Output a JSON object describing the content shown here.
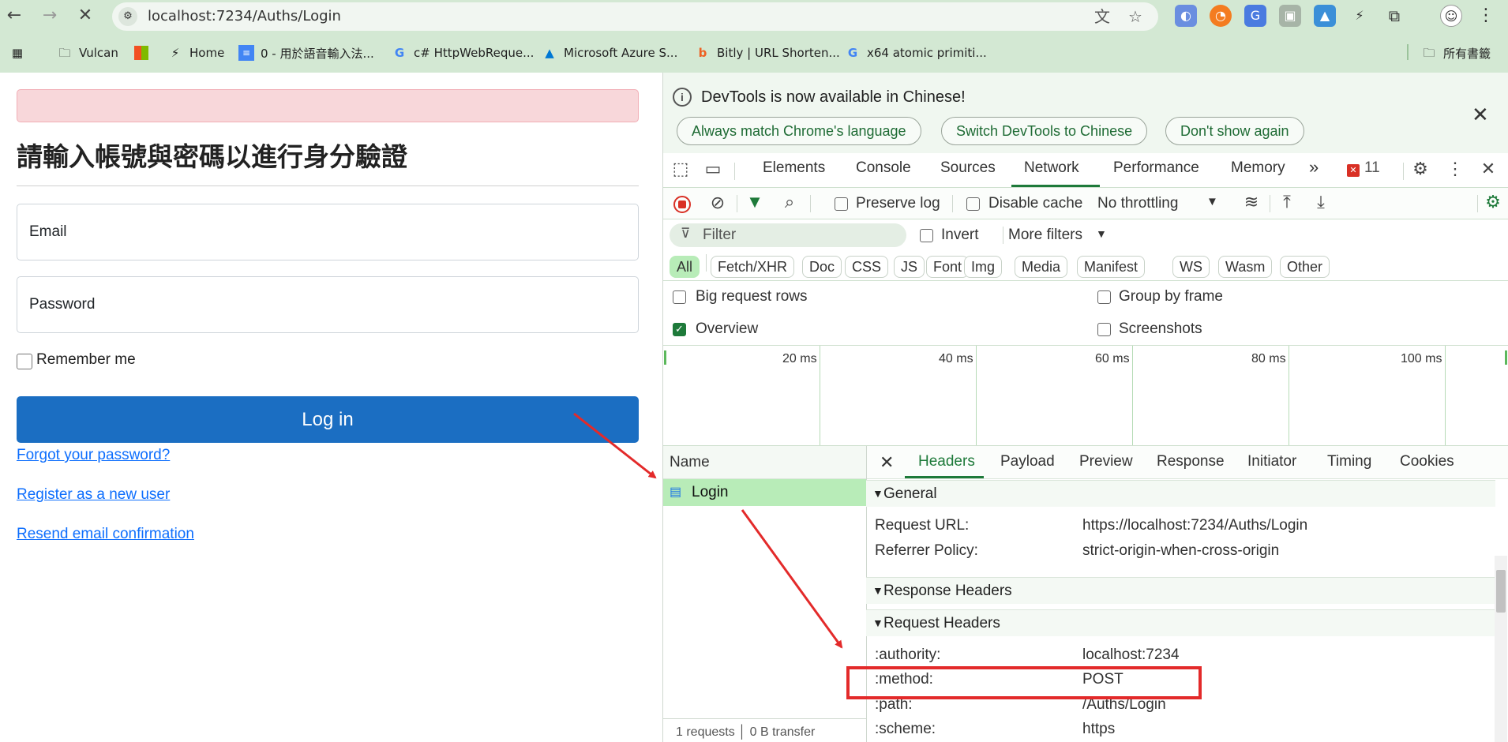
{
  "browser": {
    "url": "localhost:7234/Auths/Login",
    "bookmarks": [
      {
        "label": "Vulcan",
        "icon": "folder-icon"
      },
      {
        "label": "",
        "icon": "microsoft-icon"
      },
      {
        "label": "Home",
        "icon": "bolt-icon"
      },
      {
        "label": "0 - 用於語音輸入法...",
        "icon": "docs-icon"
      },
      {
        "label": "c# HttpWebReque...",
        "icon": "google-icon"
      },
      {
        "label": "Microsoft Azure S...",
        "icon": "azure-icon"
      },
      {
        "label": "Bitly | URL Shorten...",
        "icon": "bitly-icon"
      },
      {
        "label": "x64 atomic primiti...",
        "icon": "google-icon"
      }
    ],
    "all_bookmarks": "所有書籤"
  },
  "page": {
    "heading": "請輸入帳號與密碼以進行身分驗證",
    "email_placeholder": "Email",
    "password_placeholder": "Password",
    "remember": "Remember me",
    "login": "Log in",
    "forgot": "Forgot your password?",
    "register": "Register as a new user",
    "resend": "Resend email confirmation"
  },
  "devtools": {
    "infobar": {
      "text": "DevTools is now available in Chinese!",
      "btn1": "Always match Chrome's language",
      "btn2": "Switch DevTools to Chinese",
      "btn3": "Don't show again"
    },
    "tabs": [
      "Elements",
      "Console",
      "Sources",
      "Network",
      "Performance",
      "Memory"
    ],
    "active_tab": "Network",
    "error_count": "11",
    "toolbar": {
      "preserve_log": "Preserve log",
      "disable_cache": "Disable cache",
      "throttling": "No throttling"
    },
    "filter": {
      "placeholder": "Filter",
      "invert": "Invert",
      "more_filters": "More filters"
    },
    "type_chips": [
      "All",
      "Fetch/XHR",
      "Doc",
      "CSS",
      "JS",
      "Font",
      "Img",
      "Media",
      "Manifest",
      "WS",
      "Wasm",
      "Other"
    ],
    "options": {
      "big_rows": "Big request rows",
      "group_by_frame": "Group by frame",
      "overview": "Overview",
      "screenshots": "Screenshots"
    },
    "overview_checked": true,
    "timeline_ticks": [
      "20 ms",
      "40 ms",
      "60 ms",
      "80 ms",
      "100 ms"
    ],
    "name_col": "Name",
    "request_name": "Login",
    "detail_tabs": [
      "Headers",
      "Payload",
      "Preview",
      "Response",
      "Initiator",
      "Timing",
      "Cookies"
    ],
    "active_detail_tab": "Headers",
    "general": {
      "title": "General",
      "rows": [
        {
          "k": "Request URL:",
          "v": "https://localhost:7234/Auths/Login"
        },
        {
          "k": "Referrer Policy:",
          "v": "strict-origin-when-cross-origin"
        }
      ]
    },
    "response_headers": "Response Headers",
    "request_headers": {
      "title": "Request Headers",
      "rows": [
        {
          "k": ":authority:",
          "v": "localhost:7234"
        },
        {
          "k": ":method:",
          "v": "POST"
        },
        {
          "k": ":path:",
          "v": "/Auths/Login"
        },
        {
          "k": ":scheme:",
          "v": "https"
        }
      ]
    },
    "status": "1 requests │ 0 B transfer"
  },
  "colors": {
    "chrome_bg": "#d3e8d3",
    "login_btn": "#1b6ec2",
    "highlight": "#e32a2a",
    "selected_row": "#b8ecb8"
  }
}
